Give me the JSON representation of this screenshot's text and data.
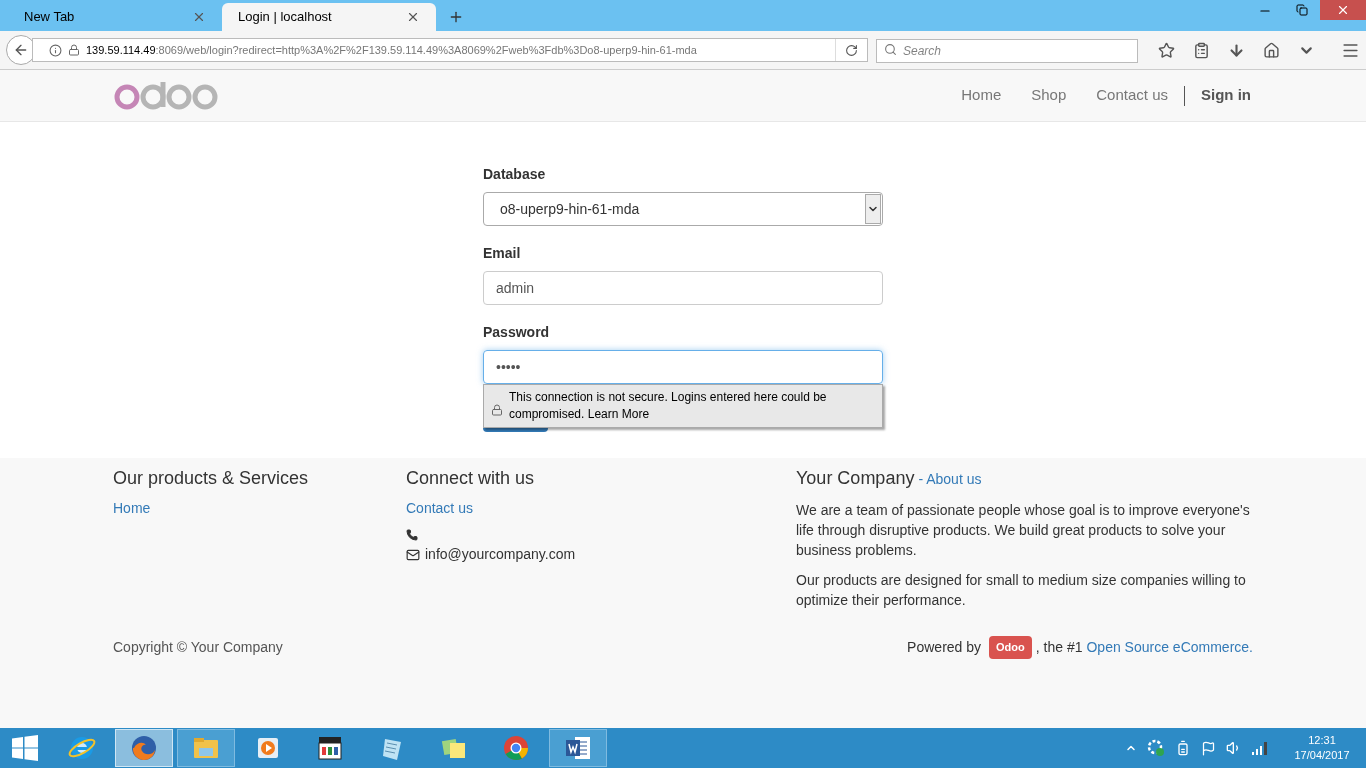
{
  "browser": {
    "tabs": [
      {
        "title": "New Tab",
        "selected": false
      },
      {
        "title": "Login | localhost",
        "selected": true
      }
    ],
    "url": {
      "host": "139.59.114.49",
      "rest": ":8069/web/login?redirect=http%3A%2F%2F139.59.114.49%3A8069%2Fweb%3Fdb%3Do8-uperp9-hin-61-mda"
    },
    "search": {
      "placeholder": "Search"
    }
  },
  "site_nav": {
    "items": [
      {
        "label": "Home",
        "kind": "link"
      },
      {
        "label": "Shop",
        "kind": "link"
      },
      {
        "label": "Contact us",
        "kind": "link"
      },
      {
        "label": "Sign in",
        "kind": "signin"
      }
    ]
  },
  "login_form": {
    "database": {
      "label": "Database",
      "value": "o8-uperp9-hin-61-mda"
    },
    "email": {
      "label": "Email",
      "value": "admin"
    },
    "password": {
      "label": "Password",
      "value": "•••••"
    },
    "warning": {
      "text": "This connection is not secure. Logins entered here could be compromised.",
      "link": "Learn More"
    }
  },
  "footer": {
    "products": {
      "title": "Our products & Services",
      "links": [
        "Home"
      ]
    },
    "connect": {
      "title": "Connect with us",
      "link": "Contact us",
      "email": "info@yourcompany.com"
    },
    "company": {
      "title": "Your Company",
      "link": "- About us",
      "paragraphs": [
        "We are a team of passionate people whose goal is to improve everyone's life through disruptive products. We build great products to solve your business problems.",
        "Our products are designed for small to medium size companies willing to optimize their performance."
      ]
    },
    "copyright": "Copyright © Your Company",
    "powered": {
      "prefix": "Powered by",
      "badge": "Odoo",
      "middle": ", the #1",
      "link": "Open Source eCommerce."
    }
  },
  "taskbar": {
    "apps": [
      {
        "kind": "ie",
        "selected": false,
        "running": false
      },
      {
        "kind": "firefox",
        "selected": true,
        "running": true
      },
      {
        "kind": "explorer",
        "selected": false,
        "running": true
      },
      {
        "kind": "media",
        "selected": false,
        "running": false
      },
      {
        "kind": "clapper",
        "selected": false,
        "running": false
      },
      {
        "kind": "notepad",
        "selected": false,
        "running": false
      },
      {
        "kind": "notes",
        "selected": false,
        "running": false
      },
      {
        "kind": "chrome",
        "selected": false,
        "running": false
      },
      {
        "kind": "word",
        "selected": false,
        "running": true
      }
    ],
    "time": "12:31",
    "date": "17/04/2017"
  }
}
